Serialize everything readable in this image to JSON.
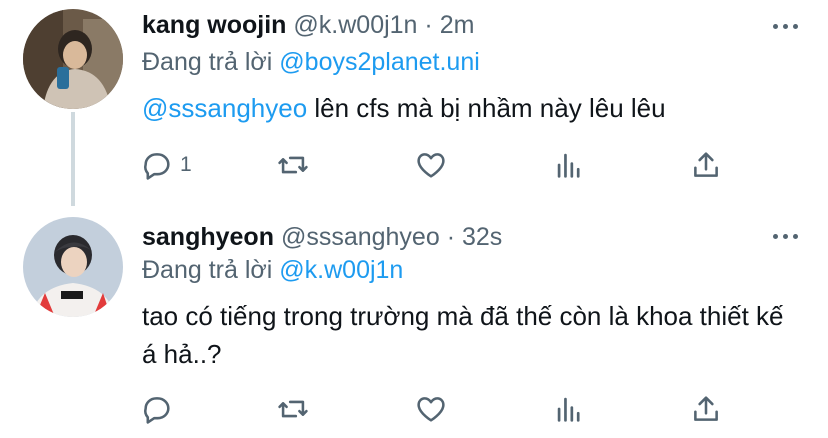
{
  "tweets": [
    {
      "name": "kang woojin",
      "handle": "@k.w00j1n",
      "separator": "·",
      "time": "2m",
      "reply_prefix": "Đang trả lời ",
      "reply_to": "@boys2planet.uni",
      "body_mention": "@sssanghyeo",
      "body_text": " lên cfs mà bị nhầm này lêu lêu",
      "reply_count": "1",
      "avatar_colors": [
        "#5b4a3a",
        "#cfc3b5"
      ]
    },
    {
      "name": "sanghyeon",
      "handle": "@sssanghyeo",
      "separator": "·",
      "time": "32s",
      "reply_prefix": "Đang trả lời ",
      "reply_to": "@k.w00j1n",
      "body_text": "tao có tiếng trong trường mà đã thế còn là khoa thiết kế á hả..?",
      "reply_count": "",
      "avatar_colors": [
        "#b9c6d6",
        "#e23b3b"
      ]
    }
  ],
  "colors": {
    "link": "#1d9bf0",
    "muted": "#536471",
    "text": "#0f1419",
    "thread_line": "#cfd9de"
  },
  "icons": [
    "reply-icon",
    "retweet-icon",
    "like-icon",
    "stats-icon",
    "share-icon",
    "more-icon"
  ]
}
